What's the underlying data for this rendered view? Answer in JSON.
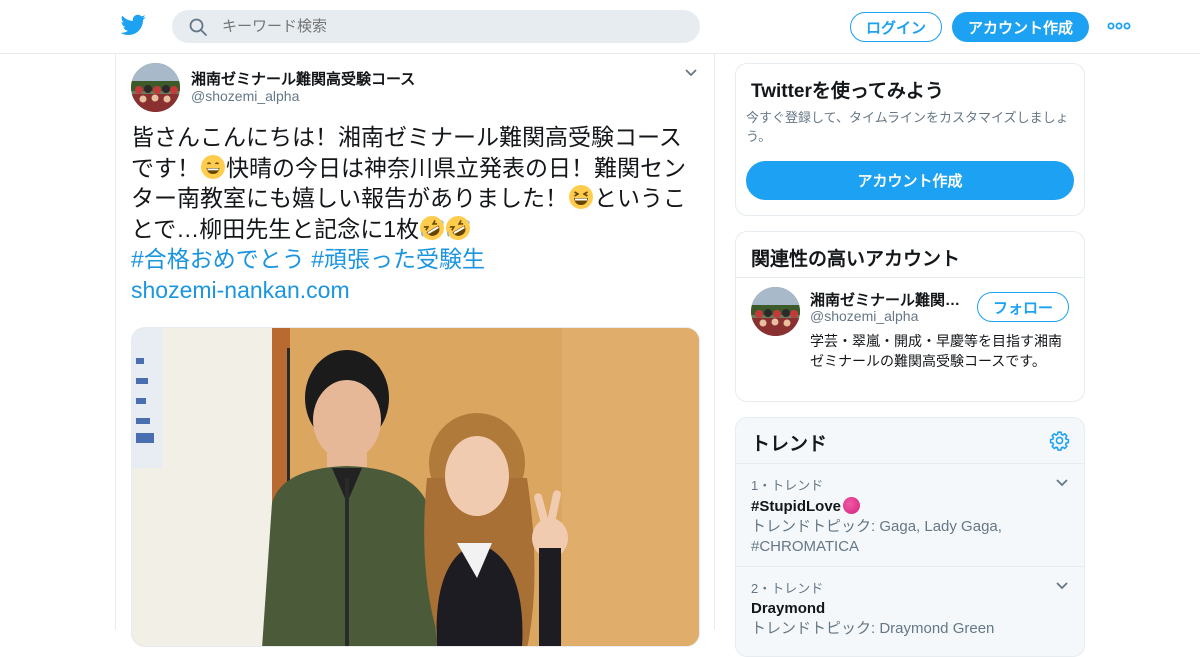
{
  "header": {
    "search_placeholder": "キーワード検索",
    "login_label": "ログイン",
    "signup_label": "アカウント作成"
  },
  "tweet": {
    "author_name": "湘南ゼミナール難関高受験コース",
    "author_handle": "@shozemi_alpha",
    "text_1": "皆さんこんにちは！湘南ゼミナール難関高受験コースです！",
    "text_2": "快晴の今日は神奈川県立発表の日！難関センター南教室にも嬉しい報告がありました！",
    "text_3": "ということで…柳田先生と記念に1枚",
    "hashtag_1": "#合格おめでとう",
    "hashtag_2": "#頑張った受験生",
    "link": "shozemi-nankan.com"
  },
  "signup_card": {
    "title": "Twitterを使ってみよう",
    "subtitle": "今すぐ登録して、タイムラインをカスタマイズしましょう。",
    "button_label": "アカウント作成"
  },
  "related_card": {
    "title": "関連性の高いアカウント",
    "account_name": "湘南ゼミナール難関…",
    "account_handle": "@shozemi_alpha",
    "follow_label": "フォロー",
    "bio": "学芸・翠嵐・開成・早慶等を目指す湘南ゼミナールの難関高受験コースです。"
  },
  "trends": {
    "title": "トレンド",
    "items": [
      {
        "rank": "1・トレンド",
        "name": "#StupidLove",
        "desc": "トレンドトピック: Gaga, Lady Gaga, #CHROMATICA"
      },
      {
        "rank": "2・トレンド",
        "name": "Draymond",
        "desc": "トレンドトピック: Draymond Green"
      }
    ]
  },
  "colors": {
    "accent": "#1da1f2",
    "link": "#1b95e0",
    "muted": "#657786",
    "border": "#e6ecf0"
  }
}
